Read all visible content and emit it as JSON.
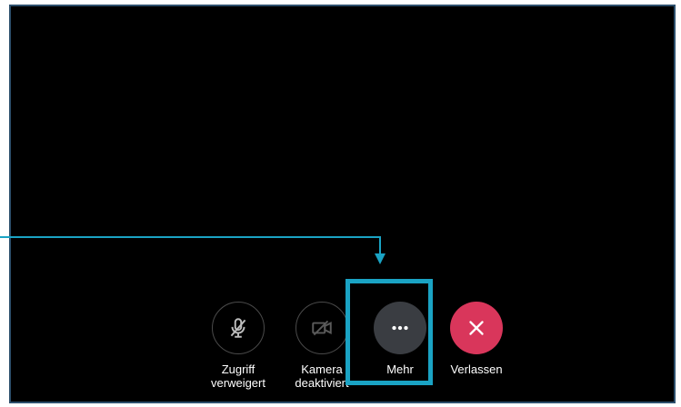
{
  "controls": {
    "mic": {
      "label_line1": "Zugriff",
      "label_line2": "verweigert",
      "icon": "mic-off-icon"
    },
    "camera": {
      "label_line1": "Kamera",
      "label_line2": "deaktiviert",
      "icon": "camera-off-icon"
    },
    "more": {
      "label": "Mehr",
      "icon": "more-dots-icon"
    },
    "leave": {
      "label": "Verlassen",
      "icon": "close-icon"
    }
  },
  "colors": {
    "accent_callout": "#1aa3c4",
    "leave_red": "#d9365b",
    "more_gray": "#3a3d42",
    "screen_bg": "#000000"
  }
}
